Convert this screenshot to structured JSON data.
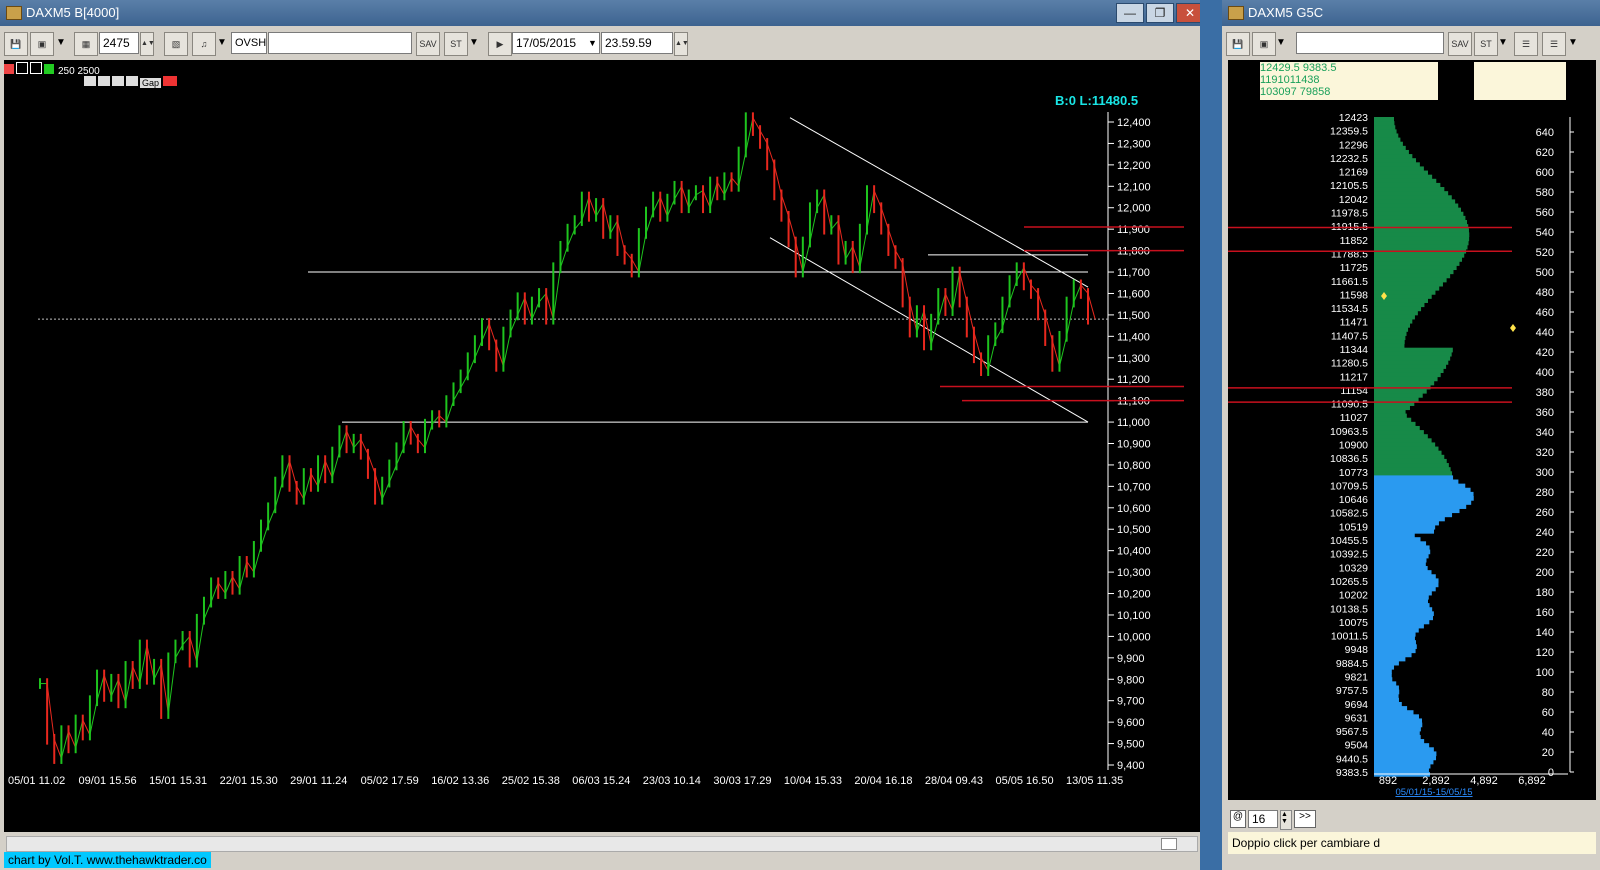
{
  "left_window": {
    "title": "DAXM5 B[4000]",
    "toolbar": {
      "bars_value": "2475",
      "study_name": "OVSH",
      "date": "17/05/2015",
      "time": "23.59.59"
    },
    "indicator_bar": {
      "row1_text": "250  2500",
      "row2_text": "Gap"
    },
    "status_text": "B:0 L:11480.5",
    "credit": "chart by Vol.T. www.thehawktrader.co"
  },
  "right_window": {
    "title": "DAXM5 G5C",
    "info_lines": [
      "12429.5 9383.5",
      "1191011438",
      "103097 79858"
    ],
    "date_range": "05/01/15-15/05/15",
    "ticks_value": "16",
    "next_button": ">>",
    "hint": "Doppio click per cambiare d"
  },
  "chart_data": {
    "type": "line",
    "x_labels": [
      "05/01 11.02",
      "09/01 15.56",
      "15/01 15.31",
      "22/01 15.30",
      "29/01 11.24",
      "05/02 17.59",
      "16/02 13.36",
      "25/02 15.38",
      "06/03 15.24",
      "23/03 10.14",
      "30/03 17.29",
      "10/04 15.33",
      "20/04 16.18",
      "28/04 09.43",
      "05/05 16.50",
      "13/05 11.35"
    ],
    "y_ticks": [
      "12,400",
      "12,300",
      "12,200",
      "12,100",
      "12,000",
      "11,900",
      "11,800",
      "11,700",
      "11,600",
      "11,500",
      "11,400",
      "11,300",
      "11,200",
      "11,100",
      "11,000",
      "10,900",
      "10,800",
      "10,700",
      "10,600",
      "10,500",
      "10,400",
      "10,300",
      "10,200",
      "10,100",
      "10,000",
      "9,900",
      "9,800",
      "9,700",
      "9,600",
      "9,500",
      "9,400"
    ],
    "ylim": [
      9380,
      12440
    ],
    "series": [
      {
        "values": [
          9780,
          9520,
          9430,
          9560,
          9480,
          9610,
          9540,
          9700,
          9820,
          9720,
          9800,
          9690,
          9860,
          9780,
          9960,
          9800,
          9870,
          9640,
          9900,
          9960,
          10000,
          9880,
          10080,
          10160,
          10250,
          10200,
          10280,
          10220,
          10350,
          10300,
          10420,
          10520,
          10600,
          10720,
          10820,
          10700,
          10640,
          10760,
          10700,
          10820,
          10740,
          10860,
          10960,
          10880,
          10920,
          10850,
          10760,
          10640,
          10720,
          10800,
          10880,
          10980,
          10920,
          10880,
          10990,
          11030,
          11000,
          11100,
          11160,
          11220,
          11300,
          11380,
          11460,
          11360,
          11260,
          11420,
          11500,
          11580,
          11480,
          11560,
          11600,
          11480,
          11720,
          11820,
          11900,
          11940,
          12050,
          11960,
          12020,
          11880,
          11940,
          11800,
          11760,
          11700,
          11880,
          11980,
          12050,
          11960,
          12040,
          12100,
          12000,
          12060,
          12080,
          12000,
          12120,
          12060,
          12140,
          12100,
          12260,
          12420,
          12360,
          12300,
          12200,
          12060,
          11960,
          11840,
          11700,
          11840,
          12000,
          12060,
          11900,
          11940,
          11760,
          11820,
          11720,
          11900,
          12080,
          12000,
          11900,
          11800,
          11740,
          11560,
          11420,
          11520,
          11360,
          11480,
          11600,
          11520,
          11700,
          11560,
          11420,
          11300,
          11240,
          11380,
          11440,
          11560,
          11660,
          11720,
          11640,
          11600,
          11500,
          11380,
          11260,
          11400,
          11560,
          11640,
          11600,
          11480
        ]
      }
    ],
    "horizontal_levels": [
      {
        "label": "11.910",
        "value": 11910
      },
      {
        "label": "11.800",
        "value": 11800
      },
      {
        "label": "11.166",
        "value": 11166
      },
      {
        "label": "11.100",
        "value": 11100
      }
    ],
    "last_price": 11480.5
  },
  "profile_data": {
    "type": "bar",
    "orientation": "horizontal",
    "price_labels": [
      "12423",
      "12359.5",
      "12296",
      "12232.5",
      "12169",
      "12105.5",
      "12042",
      "11978.5",
      "11915.5",
      "11852",
      "11788.5",
      "11725",
      "11661.5",
      "11598",
      "11534.5",
      "11471",
      "11407.5",
      "11344",
      "11280.5",
      "11217",
      "11154",
      "11090.5",
      "11027",
      "10963.5",
      "10900",
      "10836.5",
      "10773",
      "10709.5",
      "10646",
      "10582.5",
      "10519",
      "10455.5",
      "10392.5",
      "10329",
      "10265.5",
      "10202",
      "10138.5",
      "10075",
      "10011.5",
      "9948",
      "9884.5",
      "9821",
      "9757.5",
      "9694",
      "9631",
      "9567.5",
      "9504",
      "9440.5",
      "9383.5"
    ],
    "volume_ticks": [
      "892",
      "2,892",
      "4,892",
      "6,892"
    ],
    "right_axis_ticks": [
      "640",
      "620",
      "600",
      "580",
      "560",
      "540",
      "520",
      "500",
      "480",
      "460",
      "440",
      "420",
      "400",
      "380",
      "360",
      "340",
      "320",
      "300",
      "280",
      "260",
      "240",
      "220",
      "200",
      "180",
      "160",
      "140",
      "120",
      "100",
      "80",
      "60",
      "40",
      "20",
      "0"
    ],
    "split_price": 10773,
    "colors": {
      "upper": "#178a48",
      "lower": "#2a9af0"
    }
  },
  "colors": {
    "level_line": "#c8101e",
    "level_text": "#e8141e",
    "status_text": "#19e6e6",
    "channel": "#ffffff"
  }
}
